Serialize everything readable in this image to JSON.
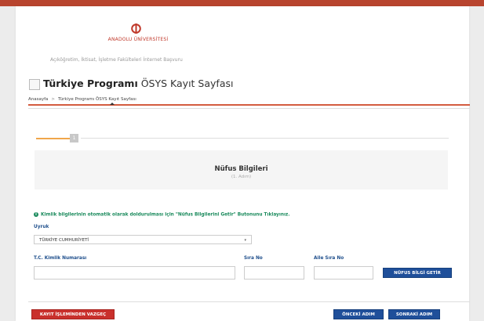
{
  "header": {
    "logo_icon": "anadolu-logo-icon",
    "university": "ANADOLU ÜNİVERSİTESİ",
    "subtitle": "Açıköğretim, İktisat, İşletme Fakülteleri İnternet Başvuru"
  },
  "page": {
    "title_bold": "Türkiye Programı",
    "title_rest": " ÖSYS Kayıt Sayfası"
  },
  "breadcrumb": {
    "home": "Anasayfa",
    "separator": ">",
    "current": "Türkiye Programı ÖSYS Kayıt Sayfası"
  },
  "steps": {
    "current_number": "1"
  },
  "section": {
    "title": "Nüfus Bilgileri",
    "subtitle": "(1. Adım)"
  },
  "info": {
    "text": "Kimlik bilgilerinin otomatik olarak doldurulması için \"Nüfus Bilgilerini Getir\" Butonunu Tıklayınız."
  },
  "form": {
    "nationality_label": "Uyruk",
    "nationality_value": "TÜRKİYE CUMHURİYETİ",
    "tc_label": "T.C. Kimlik Numarası",
    "tc_value": "",
    "sira_label": "Sıra No",
    "sira_value": "",
    "aile_label": "Aile Sıra No",
    "aile_value": "",
    "fetch_button": "NÜFUS BİLGİ GETİR"
  },
  "footer": {
    "cancel_button": "KAYIT İŞLEMİNDEN VAZGEÇ",
    "prev_button": "ÖNCEKİ ADIM",
    "next_button": "SONRAKİ ADIM"
  },
  "colors": {
    "brand_red": "#c0392b",
    "accent_orange": "#d35b3f",
    "step_orange": "#f0a64a",
    "info_green": "#1a8a5c",
    "button_blue": "#1f4f9a",
    "button_red": "#c9302c"
  }
}
